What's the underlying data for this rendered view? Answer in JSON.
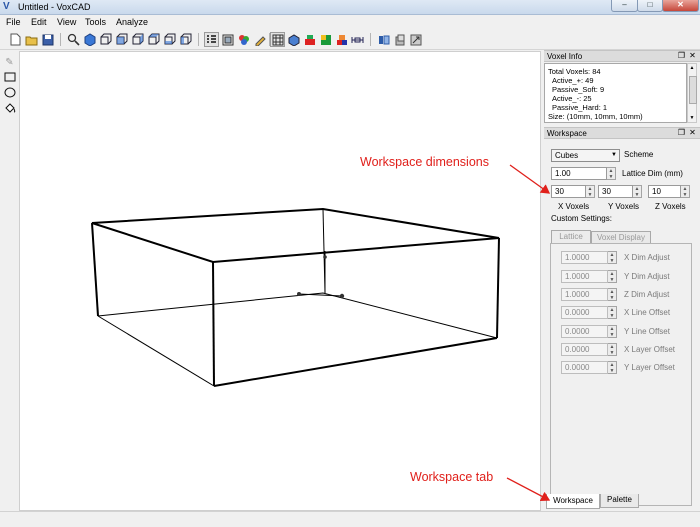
{
  "window": {
    "title": "Untitled - VoxCAD",
    "app_icon": "V",
    "minimize_glyph": "–",
    "maximize_glyph": "□",
    "close_glyph": "✕"
  },
  "menu": [
    "File",
    "Edit",
    "View",
    "Tools",
    "Analyze"
  ],
  "toolbar": {
    "icons": [
      "new-file-icon",
      "open-folder-icon",
      "save-icon",
      "zoom-icon",
      "cube-view-icon",
      "cube-front-icon",
      "cube-back-icon",
      "cube-left-icon",
      "cube-right-icon",
      "cube-top-icon",
      "cube-bottom-icon",
      "list-view-icon",
      "select-view-icon",
      "paint-icon",
      "pencil-check-icon",
      "grid-mode-icon",
      "voxel-mode-icon",
      "physics-icon",
      "stress-icon",
      "color-icon",
      "measure-icon",
      "export-icon",
      "import-icon",
      "settings-icon"
    ],
    "active_index": 15
  },
  "left_tools": [
    "pencil-icon",
    "rectangle-icon",
    "ellipse-icon",
    "bucket-fill-icon"
  ],
  "voxel_info": {
    "title": "Voxel Info",
    "lines": [
      "Total Voxels: 84",
      "Active_+: 49",
      "Passive_Soft: 9",
      "Active_-: 25",
      "Passive_Hard: 1",
      "Size: (10mm, 10mm, 10mm)"
    ]
  },
  "workspace": {
    "title": "Workspace",
    "scheme_value": "Cubes",
    "scheme_label": "Scheme",
    "lattice_dim_value": "1.00",
    "lattice_dim_label": "Lattice Dim (mm)",
    "x_voxels": "30",
    "y_voxels": "30",
    "z_voxels": "10",
    "x_label": "X Voxels",
    "y_label": "Y Voxels",
    "z_label": "Z Voxels",
    "custom_settings_label": "Custom Settings:",
    "tabs": [
      "Lattice",
      "Voxel Display"
    ],
    "rows": [
      {
        "value": "1.0000",
        "label": "X Dim Adjust"
      },
      {
        "value": "1.0000",
        "label": "Y Dim Adjust"
      },
      {
        "value": "1.0000",
        "label": "Z Dim Adjust"
      },
      {
        "value": "0.0000",
        "label": "X Line Offset"
      },
      {
        "value": "0.0000",
        "label": "Y Line Offset"
      },
      {
        "value": "0.0000",
        "label": "X Layer Offset"
      },
      {
        "value": "0.0000",
        "label": "Y Layer Offset"
      }
    ]
  },
  "bottom_tabs": [
    "Workspace",
    "Palette"
  ],
  "annotations": {
    "workspace_dimensions": "Workspace dimensions",
    "workspace_tab": "Workspace tab",
    "color": "#e0201b"
  }
}
